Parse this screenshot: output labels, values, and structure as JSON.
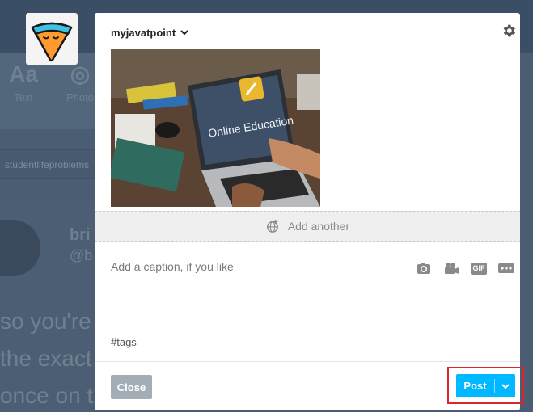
{
  "background": {
    "post_types": [
      {
        "glyph": "Aa",
        "label": "Text"
      },
      {
        "glyph": "◎",
        "label": "Photo"
      }
    ],
    "tagline": "studentlifeproblems",
    "name": "bri",
    "handle": "@b",
    "text_lines": [
      "so you're",
      "the exact",
      "once on t"
    ]
  },
  "modal": {
    "blog_name": "myjavatpoint",
    "photo_text": "Online Education",
    "add_another": "Add another",
    "caption_placeholder": "Add a caption, if you like",
    "tags_placeholder": "#tags",
    "close_label": "Close",
    "post_label": "Post",
    "gif_label": "GIF"
  },
  "colors": {
    "accent": "#00b8ff",
    "highlight": "#d9262b",
    "close_button": "#a3adb6"
  }
}
